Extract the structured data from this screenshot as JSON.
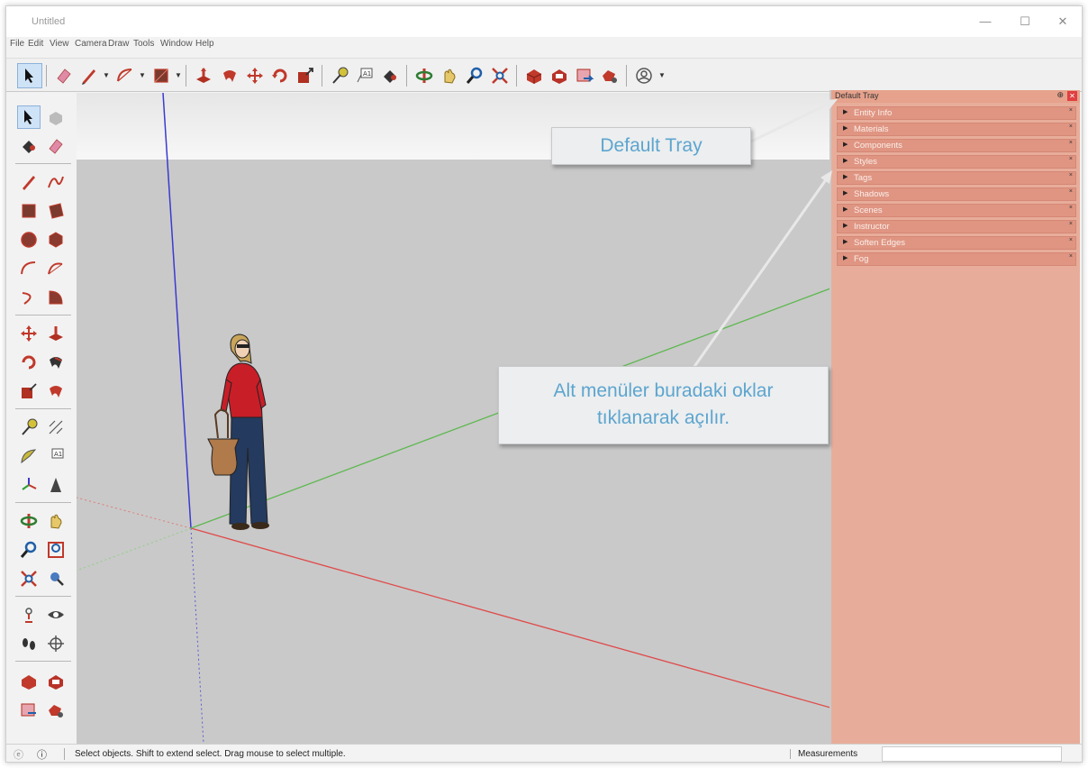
{
  "window": {
    "title": "Untitled"
  },
  "menu": [
    "File",
    "Edit",
    "View",
    "Camera",
    "Draw",
    "Tools",
    "Window",
    "Help"
  ],
  "tray": {
    "title": "Default Tray",
    "panels": [
      {
        "label": "Entity Info"
      },
      {
        "label": "Materials"
      },
      {
        "label": "Components"
      },
      {
        "label": "Styles"
      },
      {
        "label": "Tags"
      },
      {
        "label": "Shadows"
      },
      {
        "label": "Scenes"
      },
      {
        "label": "Instructor"
      },
      {
        "label": "Soften Edges"
      },
      {
        "label": "Fog"
      }
    ]
  },
  "status": {
    "text": "Select objects. Shift to extend select. Drag mouse to select multiple.",
    "measurements_label": "Measurements",
    "measurements_value": ""
  },
  "annotations": {
    "callout1": "Default Tray",
    "callout2_line1": "Alt menüler buradaki oklar",
    "callout2_line2": "tıklanarak açılır."
  },
  "colors": {
    "tray_bg": "#e8ad9a",
    "panel_header": "#df9582",
    "callout_text": "#5da5cf",
    "axis_red": "#e04a4a",
    "axis_green": "#5db84f",
    "axis_blue": "#3a3ad0"
  },
  "icons": {
    "toolbar": [
      "select-icon",
      "eraser-icon",
      "pencil-icon",
      "arc-icon",
      "rectangle-icon",
      "push-pull-icon",
      "follow-me-icon",
      "move-icon",
      "rotate-icon",
      "scale-icon",
      "tape-measure-icon",
      "text-icon",
      "paint-bucket-icon",
      "orbit-icon",
      "pan-icon",
      "zoom-icon",
      "zoom-extents-icon",
      "warehouse-icon",
      "extension-warehouse-icon",
      "layout-icon",
      "extension-manager-icon",
      "account-icon"
    ]
  }
}
